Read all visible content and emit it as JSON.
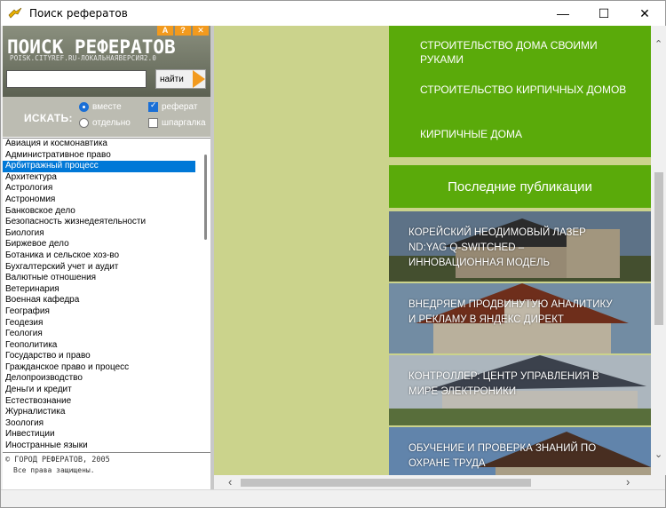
{
  "window": {
    "title": "Поиск рефератов",
    "minimize": "—",
    "maximize": "☐",
    "close": "✕"
  },
  "logo": {
    "buttons": [
      "A",
      "?",
      "✕"
    ],
    "title": "ПОИСК РЕФЕРАТОВ",
    "subtitle": "POISK.CITYREF.RU-ЛОКАЛЬНАЯВЕРСИЯ2.0"
  },
  "search": {
    "value": "",
    "go_label": "найти"
  },
  "options": {
    "label": "ИСКАТЬ:",
    "together": "вместе",
    "separately": "отдельно",
    "referat": "реферат",
    "shpargalka": "шпаргалка"
  },
  "categories": [
    "Авиация и космонавтика",
    "Административное право",
    "Арбитражный процесс",
    "Архитектура",
    "Астрология",
    "Астрономия",
    "Банковское дело",
    "Безопасность жизнедеятельности",
    "Биология",
    "Биржевое дело",
    "Ботаника и сельское хоз-во",
    "Бухгалтерский учет и аудит",
    "Валютные отношения",
    "Ветеринария",
    "Военная кафедра",
    "География",
    "Геодезия",
    "Геология",
    "Геополитика",
    "Государство и право",
    "Гражданское право и процесс",
    "Делопроизводство",
    "Деньги и кредит",
    "Естествознание",
    "Журналистика",
    "Зоология",
    "Инвестиции",
    "Иностранные языки"
  ],
  "selected_index": 2,
  "footer": {
    "line1": "© ГОРОД РЕФЕРАТОВ, 2005",
    "line2": "Все права защищены."
  },
  "links": [
    "Строительство дома своими руками",
    "Строительство кирпичных домов",
    "Кирпичные дома"
  ],
  "publications": {
    "header": "Последние публикации",
    "items": [
      "Корейский неодимовый лазер ND:YAG Q-Switched – инновационная модель",
      "Внедряем продвинутую аналитику и рекламу в Яндекс Директ",
      "Контроллер: центр управления в мире электроники",
      "Обучение и проверка знаний по охране труда"
    ]
  },
  "colors": {
    "green": "#5aaa0a",
    "olive_bg": "#cbd38c",
    "orange": "#f29a1e",
    "select_blue": "#0078d7"
  }
}
